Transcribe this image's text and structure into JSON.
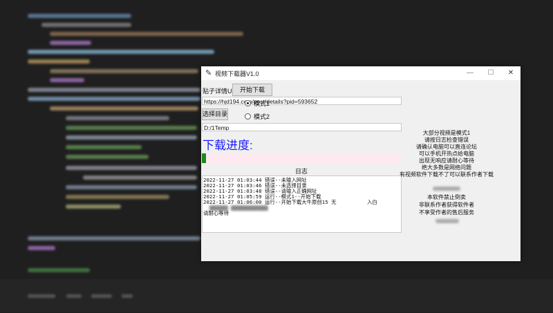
{
  "window": {
    "title": "视频下载器V1.0",
    "title_icon": "feather-icon",
    "minimize": "—",
    "maximize": "☐",
    "close": "✕"
  },
  "form": {
    "url_label": "贴子详情Url:",
    "url_value": "https://hjd194.com/post/details?pid=593652",
    "start_button": "开始下载",
    "dir_button": "选择目录",
    "dir_value": "D:/1Temp",
    "mode1_label": "模式1",
    "mode2_label": "模式2",
    "selected_mode": 1
  },
  "progress": {
    "label": "下载进度:",
    "fraction": 0.02
  },
  "log": {
    "title": "日志",
    "lines": [
      "2022-11-27 01:03:44 错误--未输入网址",
      "2022-11-27 01:03:46 错误--未选择目录",
      "2022-11-27 01:03:48 错误--请输入正确网址",
      "2022-11-27 01:05:59 运行--模式1--开始下载",
      "2022-11-27 01:06:00 运行--开始下载大牛原创15 无"
    ],
    "line5_suffix": "入白",
    "last_line": "请耐心等待"
  },
  "info": {
    "lines_top": [
      "大部分视频是模式1",
      "请按日志检查错误",
      "请确认电脑可以直连论坛",
      "可以手机开热点给电脑",
      "出现无响应请耐心等待",
      "绝大多数是网络问题",
      "有视频软件下载不了可以联系作者下载"
    ],
    "lines_bottom": [
      "本软件禁止倒卖",
      "非联系作者获得软件者",
      "不享受作者的售后服务"
    ]
  }
}
